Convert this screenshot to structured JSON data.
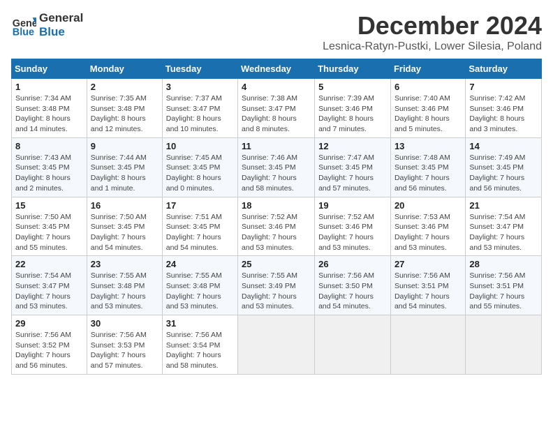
{
  "header": {
    "logo_line1": "General",
    "logo_line2": "Blue",
    "month_title": "December 2024",
    "location": "Lesnica-Ratyn-Pustki, Lower Silesia, Poland"
  },
  "weekdays": [
    "Sunday",
    "Monday",
    "Tuesday",
    "Wednesday",
    "Thursday",
    "Friday",
    "Saturday"
  ],
  "weeks": [
    [
      {
        "day": "1",
        "info": "Sunrise: 7:34 AM\nSunset: 3:48 PM\nDaylight: 8 hours\nand 14 minutes."
      },
      {
        "day": "2",
        "info": "Sunrise: 7:35 AM\nSunset: 3:48 PM\nDaylight: 8 hours\nand 12 minutes."
      },
      {
        "day": "3",
        "info": "Sunrise: 7:37 AM\nSunset: 3:47 PM\nDaylight: 8 hours\nand 10 minutes."
      },
      {
        "day": "4",
        "info": "Sunrise: 7:38 AM\nSunset: 3:47 PM\nDaylight: 8 hours\nand 8 minutes."
      },
      {
        "day": "5",
        "info": "Sunrise: 7:39 AM\nSunset: 3:46 PM\nDaylight: 8 hours\nand 7 minutes."
      },
      {
        "day": "6",
        "info": "Sunrise: 7:40 AM\nSunset: 3:46 PM\nDaylight: 8 hours\nand 5 minutes."
      },
      {
        "day": "7",
        "info": "Sunrise: 7:42 AM\nSunset: 3:46 PM\nDaylight: 8 hours\nand 3 minutes."
      }
    ],
    [
      {
        "day": "8",
        "info": "Sunrise: 7:43 AM\nSunset: 3:45 PM\nDaylight: 8 hours\nand 2 minutes."
      },
      {
        "day": "9",
        "info": "Sunrise: 7:44 AM\nSunset: 3:45 PM\nDaylight: 8 hours\nand 1 minute."
      },
      {
        "day": "10",
        "info": "Sunrise: 7:45 AM\nSunset: 3:45 PM\nDaylight: 8 hours\nand 0 minutes."
      },
      {
        "day": "11",
        "info": "Sunrise: 7:46 AM\nSunset: 3:45 PM\nDaylight: 7 hours\nand 58 minutes."
      },
      {
        "day": "12",
        "info": "Sunrise: 7:47 AM\nSunset: 3:45 PM\nDaylight: 7 hours\nand 57 minutes."
      },
      {
        "day": "13",
        "info": "Sunrise: 7:48 AM\nSunset: 3:45 PM\nDaylight: 7 hours\nand 56 minutes."
      },
      {
        "day": "14",
        "info": "Sunrise: 7:49 AM\nSunset: 3:45 PM\nDaylight: 7 hours\nand 56 minutes."
      }
    ],
    [
      {
        "day": "15",
        "info": "Sunrise: 7:50 AM\nSunset: 3:45 PM\nDaylight: 7 hours\nand 55 minutes."
      },
      {
        "day": "16",
        "info": "Sunrise: 7:50 AM\nSunset: 3:45 PM\nDaylight: 7 hours\nand 54 minutes."
      },
      {
        "day": "17",
        "info": "Sunrise: 7:51 AM\nSunset: 3:45 PM\nDaylight: 7 hours\nand 54 minutes."
      },
      {
        "day": "18",
        "info": "Sunrise: 7:52 AM\nSunset: 3:46 PM\nDaylight: 7 hours\nand 53 minutes."
      },
      {
        "day": "19",
        "info": "Sunrise: 7:52 AM\nSunset: 3:46 PM\nDaylight: 7 hours\nand 53 minutes."
      },
      {
        "day": "20",
        "info": "Sunrise: 7:53 AM\nSunset: 3:46 PM\nDaylight: 7 hours\nand 53 minutes."
      },
      {
        "day": "21",
        "info": "Sunrise: 7:54 AM\nSunset: 3:47 PM\nDaylight: 7 hours\nand 53 minutes."
      }
    ],
    [
      {
        "day": "22",
        "info": "Sunrise: 7:54 AM\nSunset: 3:47 PM\nDaylight: 7 hours\nand 53 minutes."
      },
      {
        "day": "23",
        "info": "Sunrise: 7:55 AM\nSunset: 3:48 PM\nDaylight: 7 hours\nand 53 minutes."
      },
      {
        "day": "24",
        "info": "Sunrise: 7:55 AM\nSunset: 3:48 PM\nDaylight: 7 hours\nand 53 minutes."
      },
      {
        "day": "25",
        "info": "Sunrise: 7:55 AM\nSunset: 3:49 PM\nDaylight: 7 hours\nand 53 minutes."
      },
      {
        "day": "26",
        "info": "Sunrise: 7:56 AM\nSunset: 3:50 PM\nDaylight: 7 hours\nand 54 minutes."
      },
      {
        "day": "27",
        "info": "Sunrise: 7:56 AM\nSunset: 3:51 PM\nDaylight: 7 hours\nand 54 minutes."
      },
      {
        "day": "28",
        "info": "Sunrise: 7:56 AM\nSunset: 3:51 PM\nDaylight: 7 hours\nand 55 minutes."
      }
    ],
    [
      {
        "day": "29",
        "info": "Sunrise: 7:56 AM\nSunset: 3:52 PM\nDaylight: 7 hours\nand 56 minutes."
      },
      {
        "day": "30",
        "info": "Sunrise: 7:56 AM\nSunset: 3:53 PM\nDaylight: 7 hours\nand 57 minutes."
      },
      {
        "day": "31",
        "info": "Sunrise: 7:56 AM\nSunset: 3:54 PM\nDaylight: 7 hours\nand 58 minutes."
      },
      {
        "day": "",
        "info": ""
      },
      {
        "day": "",
        "info": ""
      },
      {
        "day": "",
        "info": ""
      },
      {
        "day": "",
        "info": ""
      }
    ]
  ]
}
